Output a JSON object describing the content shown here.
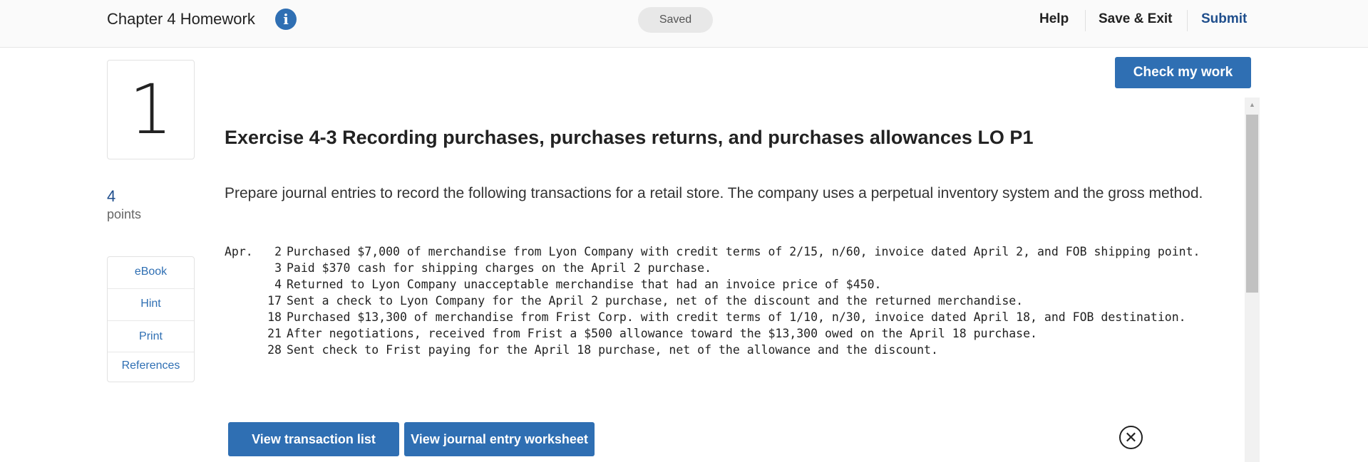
{
  "header": {
    "title": "Chapter 4 Homework",
    "info_icon": "i",
    "save_status": "Saved",
    "nav": {
      "help": "Help",
      "save_exit": "Save & Exit",
      "submit": "Submit"
    }
  },
  "question": {
    "number": "1",
    "points_value": "4",
    "points_label": "points"
  },
  "sidebar": {
    "items": [
      {
        "label": "eBook"
      },
      {
        "label": "Hint"
      },
      {
        "label": "Print"
      },
      {
        "label": "References"
      }
    ]
  },
  "actions": {
    "check_my_work": "Check my work",
    "view_transaction_list": "View transaction list",
    "view_journal_entry_worksheet": "View journal entry worksheet"
  },
  "content": {
    "exercise_title": "Exercise 4-3 Recording purchases, purchases returns, and purchases allowances LO P1",
    "prompt": "Prepare journal entries to record the following transactions for a retail store. The company uses a perpetual inventory system and the gross method.",
    "transactions": [
      {
        "month": "Apr.",
        "day": "2",
        "text": "Purchased $7,000 of merchandise from Lyon Company with credit terms of 2/15, n/60, invoice dated April 2, and FOB shipping point."
      },
      {
        "month": "",
        "day": "3",
        "text": "Paid $370 cash for shipping charges on the April 2 purchase."
      },
      {
        "month": "",
        "day": "4",
        "text": "Returned to Lyon Company unacceptable merchandise that had an invoice price of $450."
      },
      {
        "month": "",
        "day": "17",
        "text": "Sent a check to Lyon Company for the April 2 purchase, net of the discount and the returned merchandise."
      },
      {
        "month": "",
        "day": "18",
        "text": "Purchased $13,300 of merchandise from Frist Corp. with credit terms of 1/10, n/30, invoice dated April 18, and FOB destination."
      },
      {
        "month": "",
        "day": "21",
        "text": "After negotiations, received from Frist a $500 allowance toward the $13,300 owed on the April 18 purchase."
      },
      {
        "month": "",
        "day": "28",
        "text": "Sent check to Frist paying for the April 18 purchase, net of the allowance and the discount."
      }
    ]
  },
  "icons": {
    "info": "info-icon",
    "close": "close-circle-icon",
    "scroll_up": "scroll-up-arrow-icon"
  },
  "colors": {
    "accent": "#2f6fb3",
    "submit": "#1f4e8c"
  }
}
